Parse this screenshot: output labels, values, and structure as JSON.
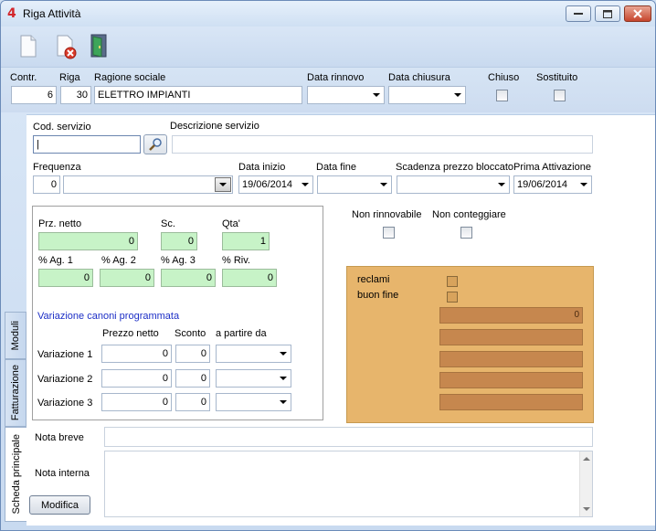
{
  "window": {
    "title": "Riga Attività"
  },
  "header": {
    "contr_label": "Contr.",
    "contr_value": "6",
    "riga_label": "Riga",
    "riga_value": "30",
    "ragione_label": "Ragione sociale",
    "ragione_value": "ELETTRO IMPIANTI",
    "data_rinnovo_label": "Data rinnovo",
    "data_rinnovo_value": "",
    "data_chiusura_label": "Data chiusura",
    "data_chiusura_value": "",
    "chiuso_label": "Chiuso",
    "sostituito_label": "Sostituito"
  },
  "tabs": [
    {
      "label": "Moduli"
    },
    {
      "label": "Fatturazione"
    },
    {
      "label": "Scheda principale"
    }
  ],
  "main": {
    "cod_servizio_label": "Cod. servizio",
    "descrizione_label": "Descrizione servizio",
    "frequenza_label": "Frequenza",
    "frequenza_value": "0",
    "data_inizio_label": "Data inizio",
    "data_inizio_value": "19/06/2014",
    "data_fine_label": "Data fine",
    "data_fine_value": "",
    "scadenza_label": "Scadenza prezzo bloccato",
    "scadenza_value": "",
    "prima_attivazione_label": "Prima Attivazione",
    "prima_attivazione_value": "19/06/2014",
    "prz_netto_label": "Prz. netto",
    "prz_netto_value": "0",
    "sc_label": "Sc.",
    "sc_value": "0",
    "qta_label": "Qta'",
    "qta_value": "1",
    "ag1_label": "% Ag. 1",
    "ag1_value": "0",
    "ag2_label": "% Ag. 2",
    "ag2_value": "0",
    "ag3_label": "% Ag. 3",
    "ag3_value": "0",
    "riv_label": "% Riv.",
    "riv_value": "0",
    "variazione_title": "Variazione canoni programmata",
    "col_prezzo": "Prezzo netto",
    "col_sconto": "Sconto",
    "col_partire": "a partire da",
    "variazioni": [
      {
        "label": "Variazione 1",
        "prezzo": "0",
        "sconto": "0",
        "data": ""
      },
      {
        "label": "Variazione 2",
        "prezzo": "0",
        "sconto": "0",
        "data": ""
      },
      {
        "label": "Variazione 3",
        "prezzo": "0",
        "sconto": "0",
        "data": ""
      }
    ],
    "non_rinnovabile_label": "Non rinnovabile",
    "non_conteggiare_label": "Non conteggiare",
    "reclami_label": "reclami",
    "buon_fine_label": "buon fine",
    "orange_value_1": "0",
    "nota_breve_label": "Nota breve",
    "nota_interna_label": "Nota interna",
    "modifica_label": "Modifica"
  },
  "colors": {
    "green_field": "#c7f3c7",
    "orange_panel": "#e7b56c",
    "variazione_title": "#1d2fc6"
  }
}
